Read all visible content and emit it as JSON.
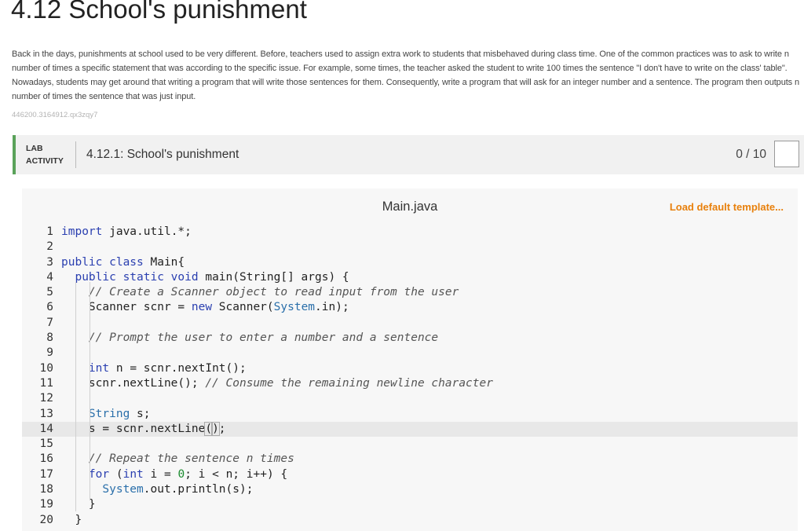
{
  "page": {
    "title": "4.12 School's punishment",
    "description": "Back in the days, punishments at school used to be very different. Before, teachers used to assign extra work to students that misbehaved during class time. One of the common practices was to ask to write n number of times a specific statement that was according to the specific issue. For example, some times, the teacher asked the student to write 100 times the sentence \"I don't have to write on the class' table\". Nowadays, students may get around that writing a program that will write those sentences for them. Consequently, write a program that will ask for an integer number and a sentence. The program then outputs n number of times the sentence that was just input.",
    "code_id": "446200.3164912.qx3zqy7"
  },
  "lab": {
    "label_line1": "LAB",
    "label_line2": "ACTIVITY",
    "name": "4.12.1: School's punishment",
    "score": "0 / 10"
  },
  "editor": {
    "file_name": "Main.java",
    "load_template": "Load default template...",
    "active_line": 14,
    "lines": [
      {
        "n": "1",
        "html": "<span class=\"kw\">import</span> java.util.*;"
      },
      {
        "n": "2",
        "html": ""
      },
      {
        "n": "3",
        "html": "<span class=\"kw\">public class</span> Main{"
      },
      {
        "n": "4",
        "html": "  <span class=\"kw\">public static void</span> main(String[] args) {"
      },
      {
        "n": "5",
        "html": "    <span class=\"cm\">// Create a Scanner object to read input from the user</span>"
      },
      {
        "n": "6",
        "html": "    Scanner scnr = <span class=\"kw\">new</span> Scanner(<span class=\"ty\">System</span>.in);"
      },
      {
        "n": "7",
        "html": ""
      },
      {
        "n": "8",
        "html": "    <span class=\"cm\">// Prompt the user to enter a number and a sentence</span>"
      },
      {
        "n": "9",
        "html": ""
      },
      {
        "n": "10",
        "html": "    <span class=\"kw\">int</span> n = scnr.nextInt();"
      },
      {
        "n": "11",
        "html": "    scnr.nextLine(); <span class=\"cm\">// Consume the remaining newline character</span>"
      },
      {
        "n": "12",
        "html": ""
      },
      {
        "n": "13",
        "html": "    <span class=\"ty\">String</span> s;"
      },
      {
        "n": "14",
        "html": "    s = scnr.nextLine<span class=\"bracket-hl\">(</span><span class=\"bracket-hl\">)</span>;"
      },
      {
        "n": "15",
        "html": ""
      },
      {
        "n": "16",
        "html": "    <span class=\"cm\">// Repeat the sentence n times</span>"
      },
      {
        "n": "17",
        "html": "    <span class=\"kw\">for</span> (<span class=\"kw\">int</span> i = <span class=\"num\">0</span>; i &lt; n; i++) {"
      },
      {
        "n": "18",
        "html": "      <span class=\"ty\">System</span>.out.println(s);"
      },
      {
        "n": "19",
        "html": "    }"
      },
      {
        "n": "20",
        "html": "  }"
      }
    ]
  }
}
